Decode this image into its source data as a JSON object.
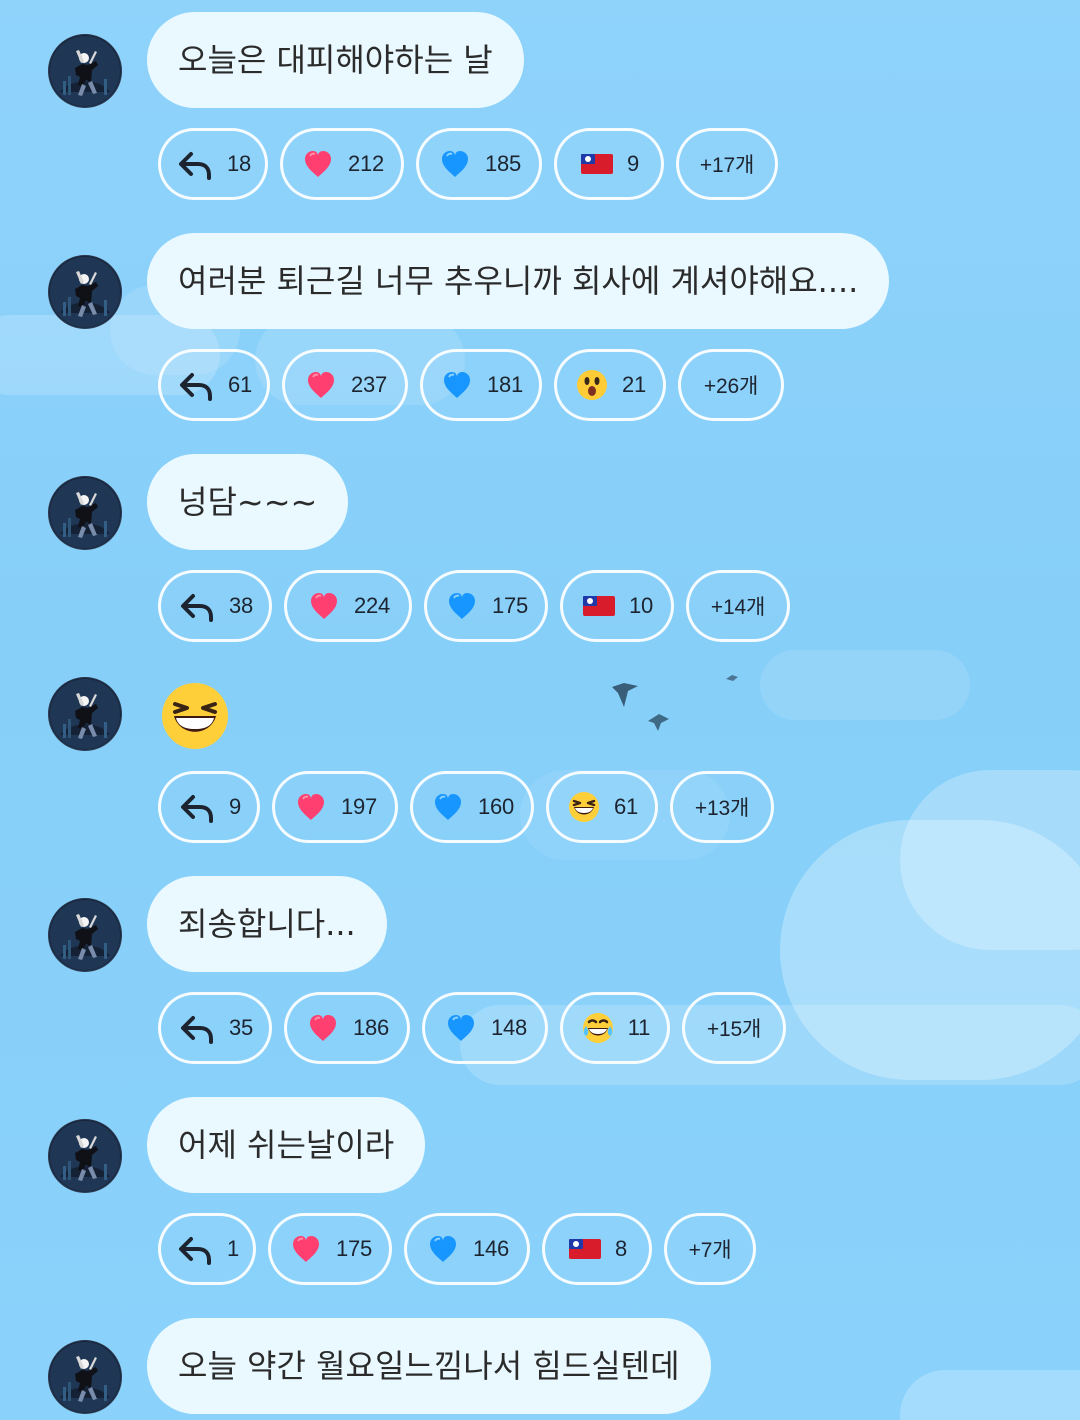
{
  "messages": [
    {
      "text": "오늘은 대피해야하는 날",
      "reply": "18",
      "red_heart": "212",
      "blue_heart": "185",
      "extra_icon": "taiwan-flag-icon",
      "extra_count": "9",
      "more": "+17개"
    },
    {
      "text": "여러분 퇴근길 너무 추우니까 회사에 계셔야해요....",
      "reply": "61",
      "red_heart": "237",
      "blue_heart": "181",
      "extra_icon": "surprised-face-icon",
      "extra_count": "21",
      "more": "+26개"
    },
    {
      "text": "넝담~~~",
      "reply": "38",
      "red_heart": "224",
      "blue_heart": "175",
      "extra_icon": "taiwan-flag-icon",
      "extra_count": "10",
      "more": "+14개"
    },
    {
      "emoji": "grinning-squinting-face-icon",
      "reply": "9",
      "red_heart": "197",
      "blue_heart": "160",
      "extra_icon": "grinning-squinting-face-icon",
      "extra_count": "61",
      "more": "+13개"
    },
    {
      "text": "죄송합니다...",
      "reply": "35",
      "red_heart": "186",
      "blue_heart": "148",
      "extra_icon": "face-with-tears-of-joy-icon",
      "extra_count": "11",
      "more": "+15개"
    },
    {
      "text": "어제 쉬는날이라",
      "reply": "1",
      "red_heart": "175",
      "blue_heart": "146",
      "extra_icon": "taiwan-flag-icon",
      "extra_count": "8",
      "more": "+7개"
    },
    {
      "text": "오늘 약간 월요일느낌나서 힘드실텐데"
    }
  ]
}
